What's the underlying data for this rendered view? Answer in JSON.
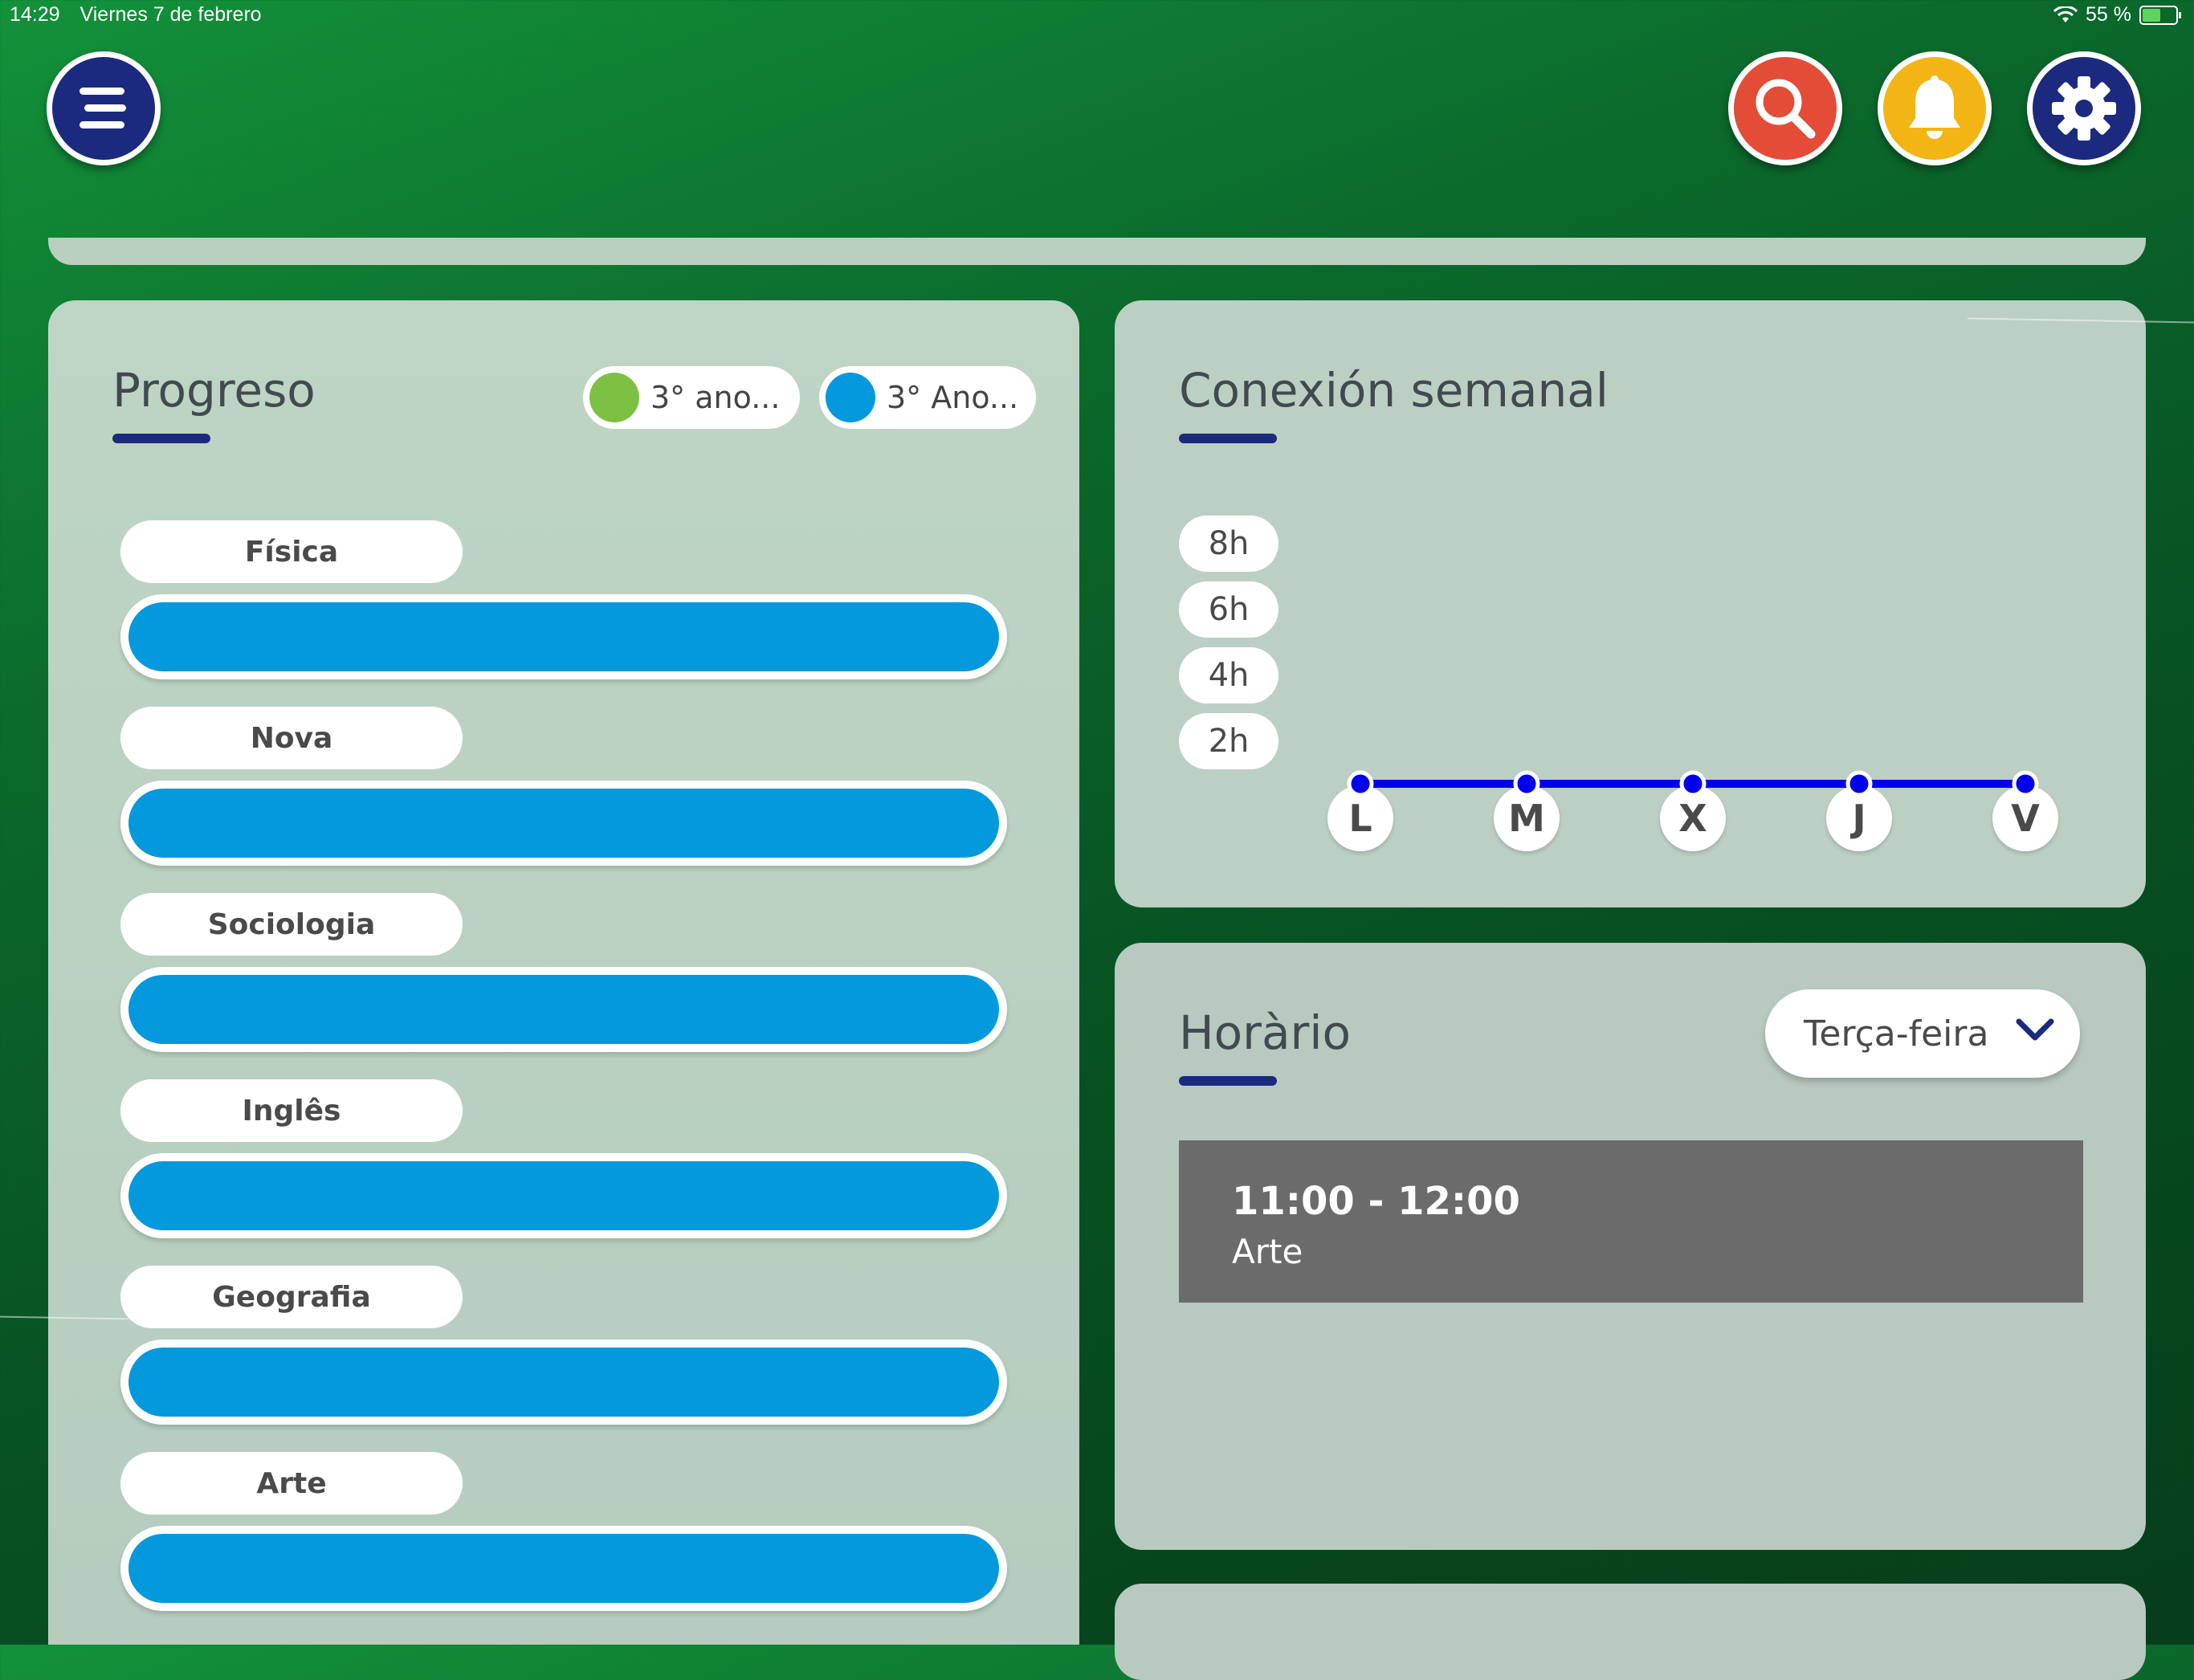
{
  "status_bar": {
    "time": "14:29",
    "date": "Viernes 7 de febrero",
    "battery": "55 %",
    "battery_level": 55
  },
  "header": {
    "menu_icon": "hamburger-icon",
    "search_icon": "search-icon",
    "bell_icon": "bell-icon",
    "gear_icon": "gear-icon",
    "colors": {
      "menu": "#1b2a7e",
      "search": "#e34c37",
      "bell": "#f2b515",
      "settings": "#1b2a7e"
    }
  },
  "progress": {
    "title": "Progreso",
    "filters": [
      {
        "label": "3° ano...",
        "color": "#7cc142"
      },
      {
        "label": "3° Ano...",
        "color": "#0399dc"
      }
    ],
    "bar_color": "#0399dc",
    "subjects": [
      {
        "name": "Física",
        "progress": 100
      },
      {
        "name": "Nova",
        "progress": 100
      },
      {
        "name": "Sociologia",
        "progress": 100
      },
      {
        "name": "Inglês",
        "progress": 100
      },
      {
        "name": "Geografia",
        "progress": 100
      },
      {
        "name": "Arte",
        "progress": 100
      }
    ]
  },
  "weekly": {
    "title": "Conexión semanal",
    "chart_data": {
      "type": "line",
      "categories": [
        "L",
        "M",
        "X",
        "J",
        "V"
      ],
      "series": [
        {
          "values": [
            0,
            0,
            0,
            0,
            0
          ]
        }
      ],
      "y_ticks": [
        "8h",
        "6h",
        "4h",
        "2h"
      ],
      "ylim": [
        0,
        8
      ],
      "line_color": "#0000ee"
    }
  },
  "schedule": {
    "title": "Horàrio",
    "day_selected": "Terça-feira",
    "slots": [
      {
        "time": "11:00 - 12:00",
        "subject": "Arte"
      }
    ]
  }
}
